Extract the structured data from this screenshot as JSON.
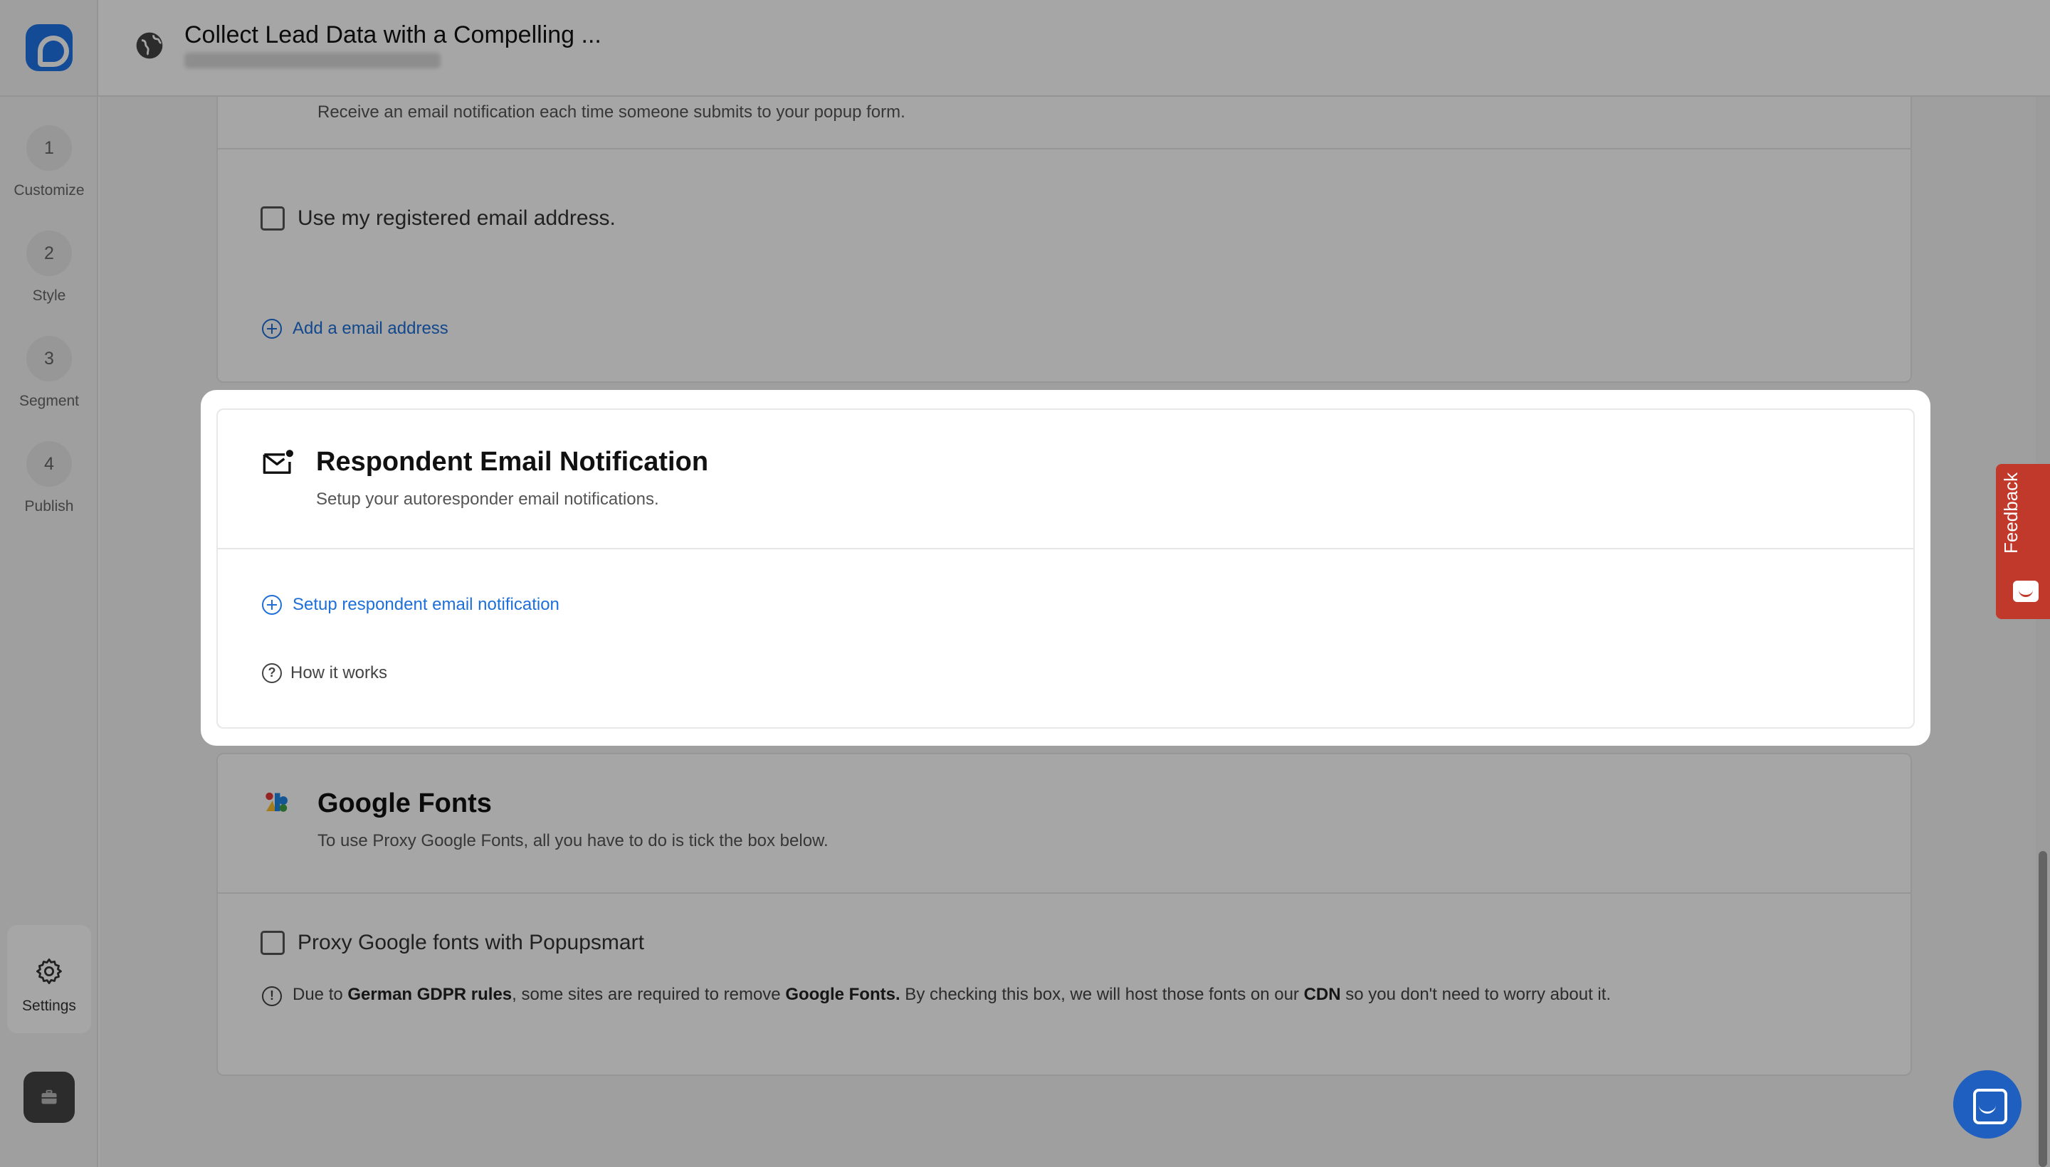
{
  "header": {
    "title": "Collect Lead Data with a Compelling ..."
  },
  "sidebar": {
    "steps": [
      {
        "num": "1",
        "label": "Customize"
      },
      {
        "num": "2",
        "label": "Style"
      },
      {
        "num": "3",
        "label": "Segment"
      },
      {
        "num": "4",
        "label": "Publish"
      }
    ],
    "settings_label": "Settings"
  },
  "email_notification": {
    "description": "Receive an email notification each time someone submits to your popup form.",
    "checkbox_label": "Use my registered email address.",
    "add_link": "Add a email address"
  },
  "respondent": {
    "title": "Respondent Email Notification",
    "description": "Setup your autoresponder email notifications.",
    "setup_link": "Setup respondent email notification",
    "how_it_works": "How it works"
  },
  "google_fonts": {
    "title": "Google Fonts",
    "description": "To use Proxy Google Fonts, all you have to do is tick the box below.",
    "checkbox_label": "Proxy Google fonts with Popupsmart",
    "note_1": "Due to ",
    "note_b1": "German GDPR rules",
    "note_2": ", some sites are required to remove ",
    "note_b2": "Google Fonts.",
    "note_3": " By checking this box, we will host those fonts on our ",
    "note_b3": "CDN",
    "note_4": " so you don't need to worry about it."
  },
  "feedback": {
    "label": "Feedback"
  },
  "colors": {
    "accent": "#1e6fd9",
    "brand": "#1e73e8",
    "feedback": "#c0392b"
  }
}
